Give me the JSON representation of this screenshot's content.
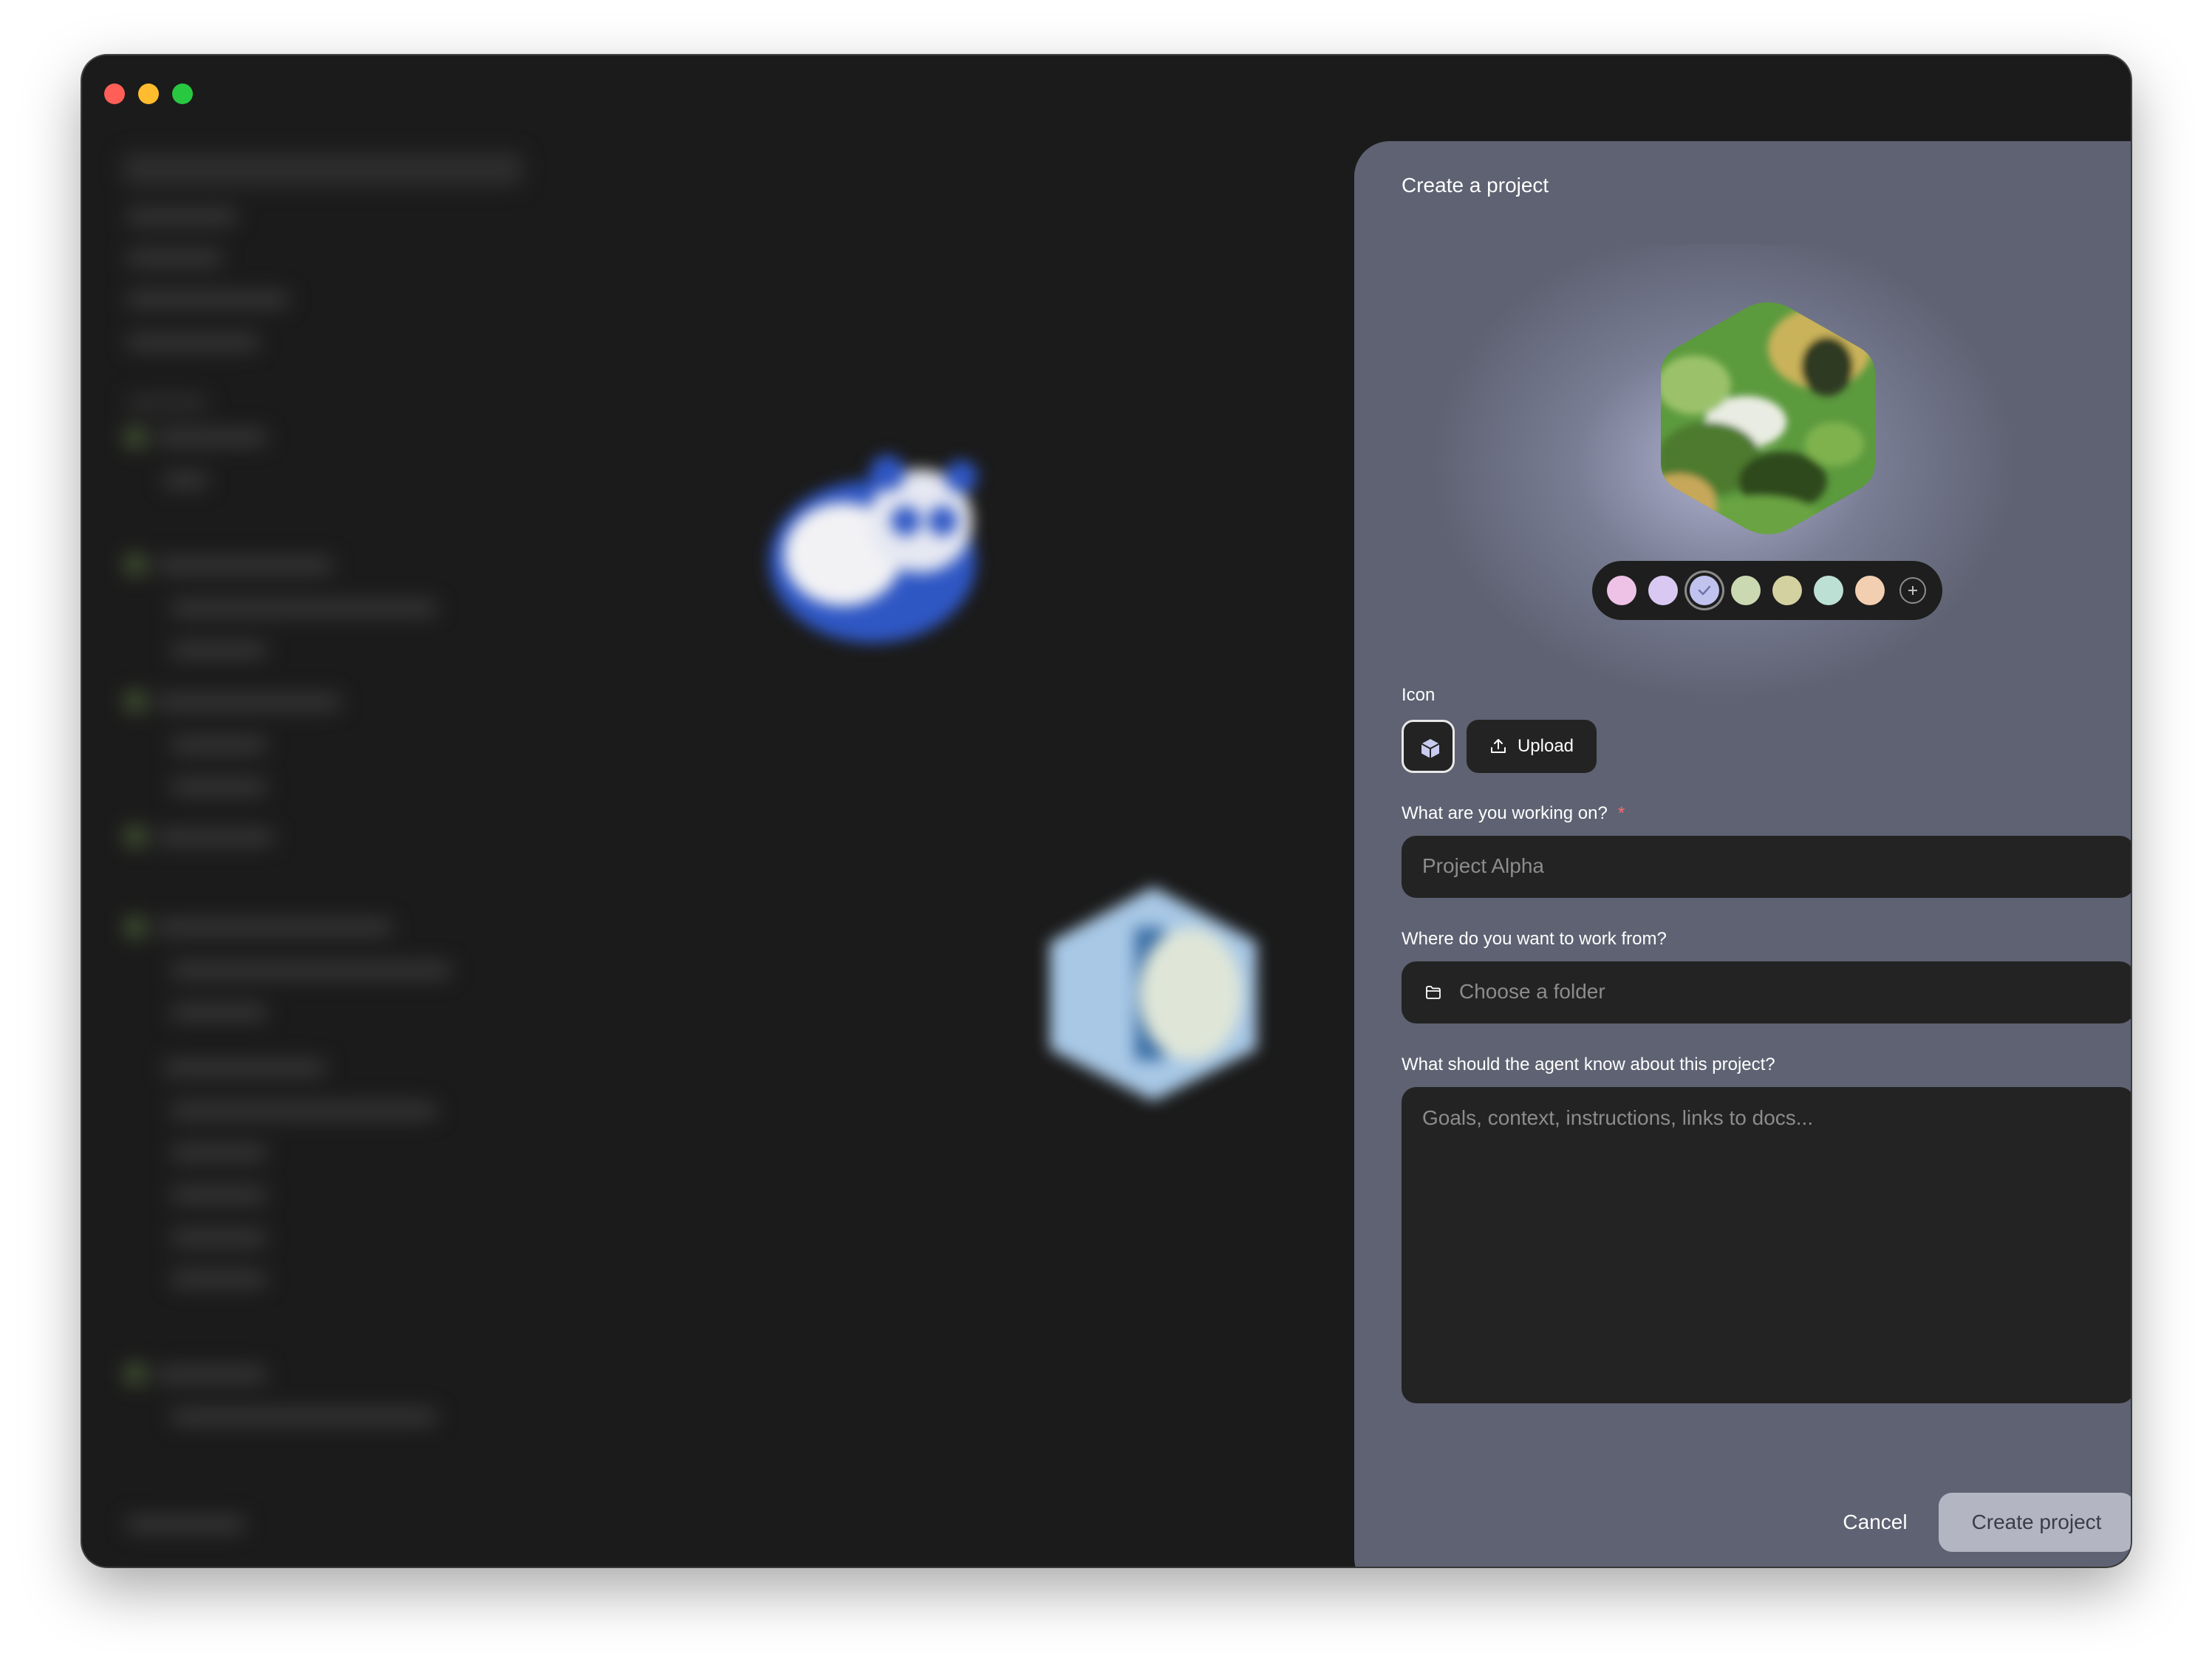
{
  "dialog": {
    "title": "Create a project",
    "close_icon": "close-icon",
    "palette": {
      "colors": [
        "#eec2e6",
        "#d9c9f2",
        "#c0c3ee",
        "#cbd9b2",
        "#d4d1a0",
        "#bde0d5",
        "#f3cfb1"
      ],
      "selected_index": 2,
      "add_icon": "plus-icon"
    },
    "icon_section": {
      "label": "Icon",
      "selected_icon": "cube-icon",
      "upload_label": "Upload"
    },
    "name_field": {
      "label": "What are you working on?",
      "required_marker": "*",
      "placeholder": "Project Alpha"
    },
    "folder_field": {
      "label": "Where do you want to work from?",
      "placeholder": "Choose a folder"
    },
    "notes_field": {
      "label": "What should the agent know about this project?",
      "placeholder": "Goals, context, instructions, links to docs..."
    },
    "cancel_label": "Cancel",
    "create_label": "Create project"
  }
}
